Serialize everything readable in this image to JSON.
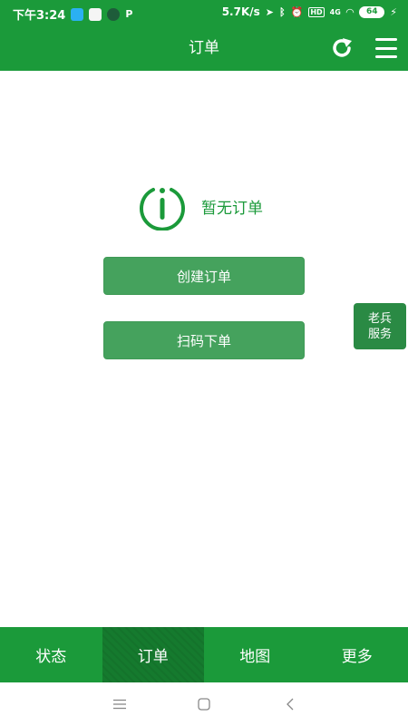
{
  "status_bar": {
    "time": "下午3:24",
    "network_speed": "5.7K/s",
    "battery": "64",
    "icons": [
      "qq-icon",
      "app-icon",
      "frog-icon",
      "p-icon",
      "location-icon",
      "bluetooth-icon",
      "alarm-icon",
      "hd-icon",
      "signal-icon",
      "wifi-icon",
      "battery-icon",
      "charging-icon"
    ],
    "signal_label": "4G"
  },
  "app_bar": {
    "title": "订单",
    "refresh_icon": "refresh-icon",
    "menu_icon": "menu-icon"
  },
  "empty_state": {
    "icon": "info-icon",
    "text": "暂无订单"
  },
  "actions": {
    "create_label": "创建订单",
    "scan_label": "扫码下单"
  },
  "service_float": {
    "line1": "老兵",
    "line2": "服务"
  },
  "bottom_nav": {
    "tabs": [
      {
        "label": "状态",
        "active": false
      },
      {
        "label": "订单",
        "active": true
      },
      {
        "label": "地图",
        "active": false
      },
      {
        "label": "更多",
        "active": false
      }
    ]
  },
  "system_nav": {
    "icons": [
      "menu-lines-icon",
      "home-square-icon",
      "back-chevron-icon"
    ]
  },
  "colors": {
    "primary": "#1b9a3a",
    "button": "#45a25d",
    "active_tab": "#157a2e"
  }
}
